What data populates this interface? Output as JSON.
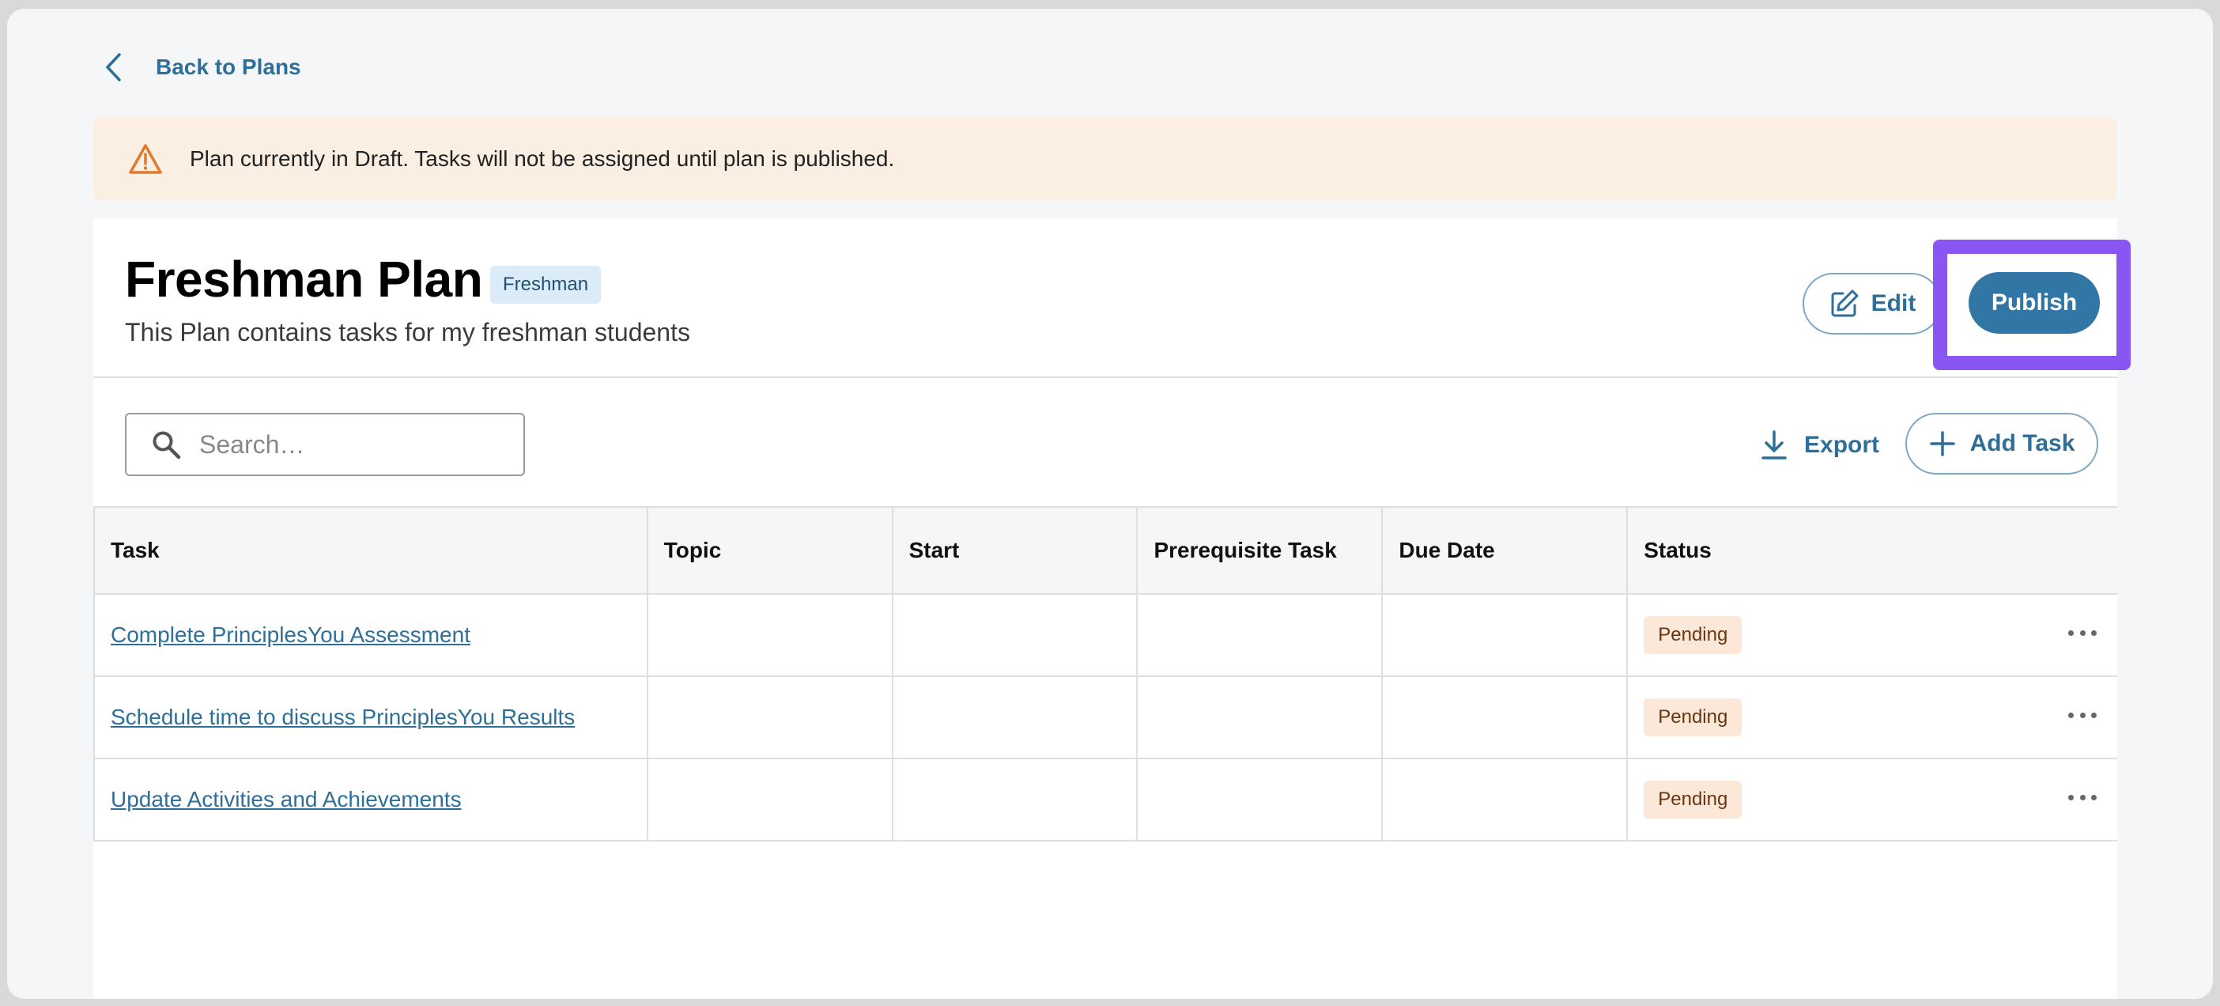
{
  "nav": {
    "back_label": "Back to Plans"
  },
  "alert": {
    "message": "Plan currently in Draft. Tasks will not be assigned until plan is published."
  },
  "plan": {
    "title": "Freshman Plan",
    "badge": "Freshman",
    "description": "This Plan contains tasks for my freshman students"
  },
  "actions": {
    "edit_label": "Edit",
    "publish_label": "Publish"
  },
  "toolbar": {
    "search_placeholder": "Search…",
    "export_label": "Export",
    "add_task_label": "Add Task"
  },
  "table": {
    "columns": [
      "Task",
      "Topic",
      "Start",
      "Prerequisite Task",
      "Due Date",
      "Status"
    ],
    "rows": [
      {
        "task": "Complete PrinciplesYou Assessment",
        "topic": "",
        "start": "",
        "prereq": "",
        "due": "",
        "status": "Pending"
      },
      {
        "task": "Schedule time to discuss PrinciplesYou Results",
        "topic": "",
        "start": "",
        "prereq": "",
        "due": "",
        "status": "Pending"
      },
      {
        "task": "Update Activities and Achievements",
        "topic": "",
        "start": "",
        "prereq": "",
        "due": "",
        "status": "Pending"
      }
    ]
  },
  "colors": {
    "accent": "#2e6f99",
    "publish_bg": "#3276a5",
    "highlight": "#8a56f3",
    "alert_bg": "#fbefe3",
    "pending_bg": "#fbe8d9"
  }
}
